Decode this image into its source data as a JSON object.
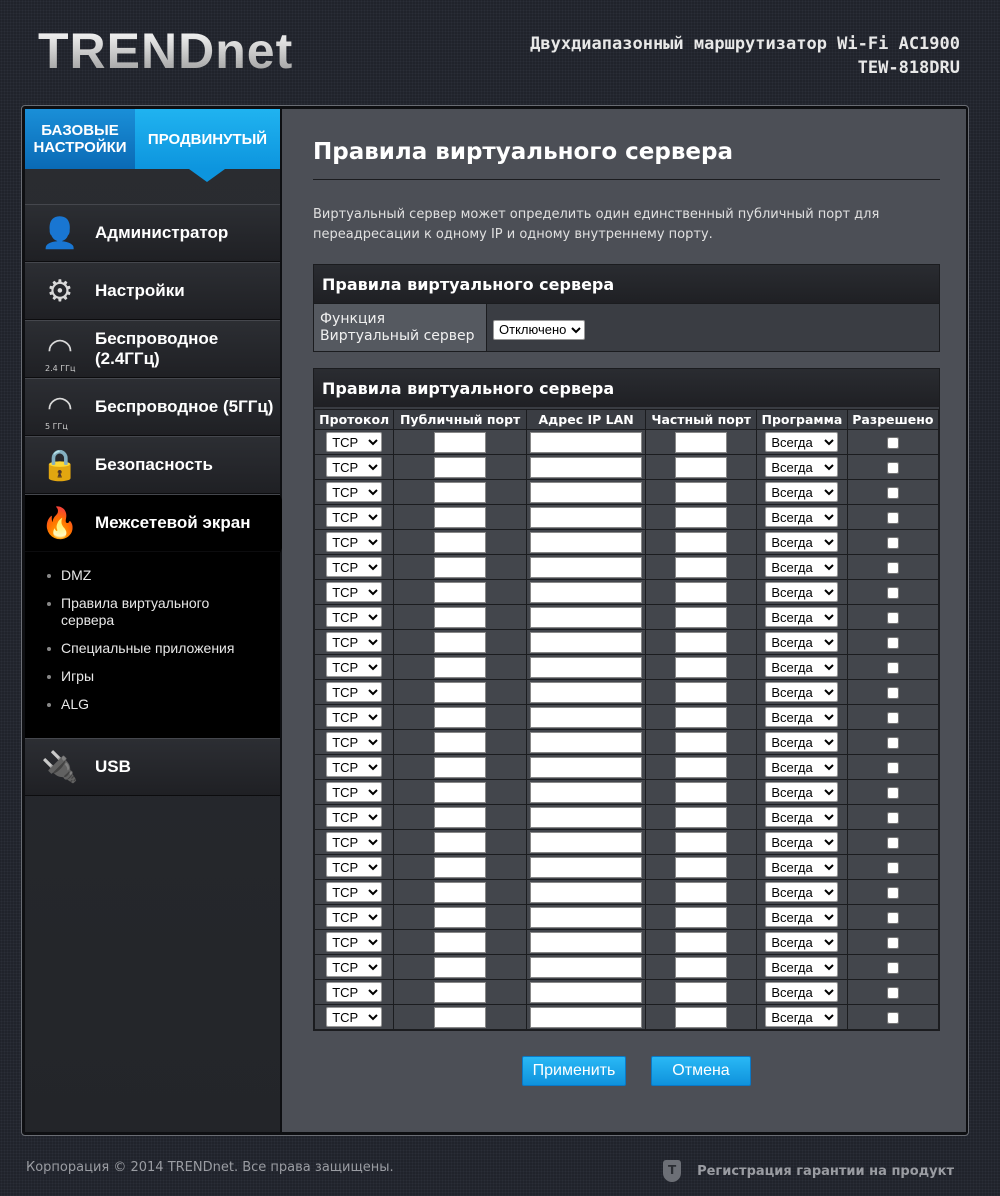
{
  "header": {
    "logo": "TRENDnet",
    "title_line1": "Двухдиапазонный маршрутизатор Wi-Fi AC1900",
    "title_line2": "TEW-818DRU"
  },
  "tabs": {
    "basic": "БАЗОВЫЕ НАСТРОЙКИ",
    "advanced": "ПРОДВИНУТЫЙ"
  },
  "nav": {
    "admin": "Администратор",
    "settings": "Настройки",
    "wireless24": "Беспроводное (2.4ГГц)",
    "wireless24_badge": "2.4 ГГц",
    "wireless5": "Беспроводное (5ГГц)",
    "wireless5_badge": "5 ГГц",
    "security": "Безопасность",
    "firewall": "Межсетевой экран",
    "usb": "USB"
  },
  "subnav": {
    "dmz": "DMZ",
    "virtual_server": "Правила виртуального сервера",
    "special_apps": "Специальные приложения",
    "games": "Игры",
    "alg": "ALG"
  },
  "page": {
    "title": "Правила виртуального сервера",
    "description": "Виртуальный сервер может определить один единственный публичный порт для переадресации к одному IP и одному внутреннему порту."
  },
  "function_box": {
    "header": "Правила виртуального сервера",
    "label": "Функция Виртуальный сервер",
    "value": "Отключено"
  },
  "rules_box": {
    "header": "Правила виртуального сервера",
    "columns": [
      "Протокол",
      "Публичный порт",
      "Адрес IP LAN",
      "Частный порт",
      "Программа",
      "Разрешено"
    ],
    "row_protocol": "TCP",
    "row_schedule": "Всегда",
    "row_count": 24
  },
  "buttons": {
    "apply": "Применить",
    "cancel": "Отмена"
  },
  "footer": {
    "copyright": "Корпорация © 2014 TRENDnet. Все права защищены.",
    "warranty": "Регистрация гарантии на продукт"
  }
}
